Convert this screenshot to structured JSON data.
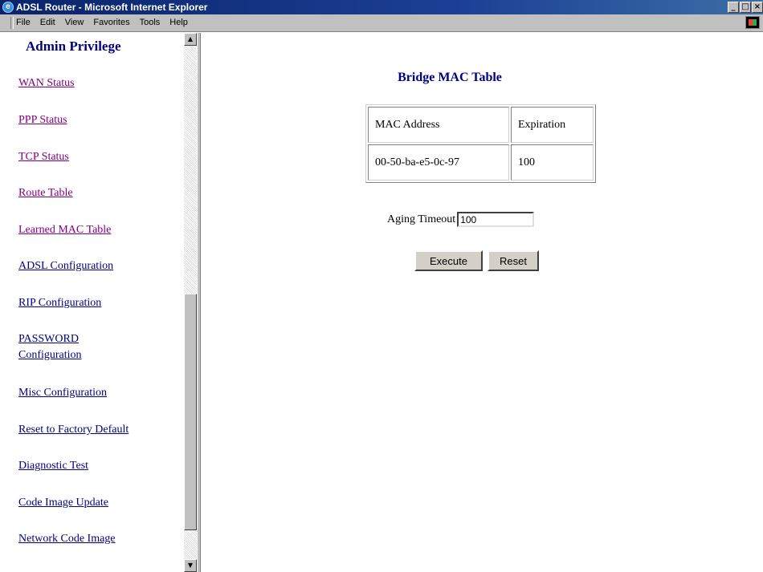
{
  "window": {
    "title": "ADSL Router - Microsoft Internet Explorer",
    "controls": {
      "minimize": "_",
      "maximize": "□",
      "close": "×"
    }
  },
  "menubar": {
    "items": [
      "File",
      "Edit",
      "View",
      "Favorites",
      "Tools",
      "Help"
    ]
  },
  "sidebar": {
    "title": "Admin Privilege",
    "links": [
      {
        "label": "WAN Status",
        "visited": true
      },
      {
        "label": "PPP Status",
        "visited": true
      },
      {
        "label": "TCP Status",
        "visited": true
      },
      {
        "label": "Route Table",
        "visited": true
      },
      {
        "label": "Learned MAC Table",
        "visited": true
      },
      {
        "label": "ADSL Configuration",
        "visited": false
      },
      {
        "label": "RIP Configuration",
        "visited": false
      },
      {
        "label": "PASSWORD Configuration",
        "line1": "PASSWORD",
        "line2": "Configuration",
        "visited": false
      },
      {
        "label": "Misc Configuration",
        "visited": false
      },
      {
        "label": "Reset to Factory Default",
        "visited": false
      },
      {
        "label": "Diagnostic Test",
        "visited": false
      },
      {
        "label": "Code Image Update",
        "visited": false
      },
      {
        "label": "Network Code Image",
        "visited": false
      }
    ],
    "scroll_position": 0.42
  },
  "main": {
    "title": "Bridge MAC Table",
    "table": {
      "headers": [
        "MAC Address",
        "Expiration"
      ],
      "rows": [
        [
          "00-50-ba-e5-0c-97",
          "100"
        ]
      ]
    },
    "aging": {
      "label": "Aging Timeout",
      "value": "100"
    },
    "buttons": {
      "execute": "Execute",
      "reset": "Reset"
    }
  },
  "colors": {
    "link": "#000080",
    "visited_link": "#800080",
    "heading": "#000080",
    "titlebar": "#0a246a"
  }
}
